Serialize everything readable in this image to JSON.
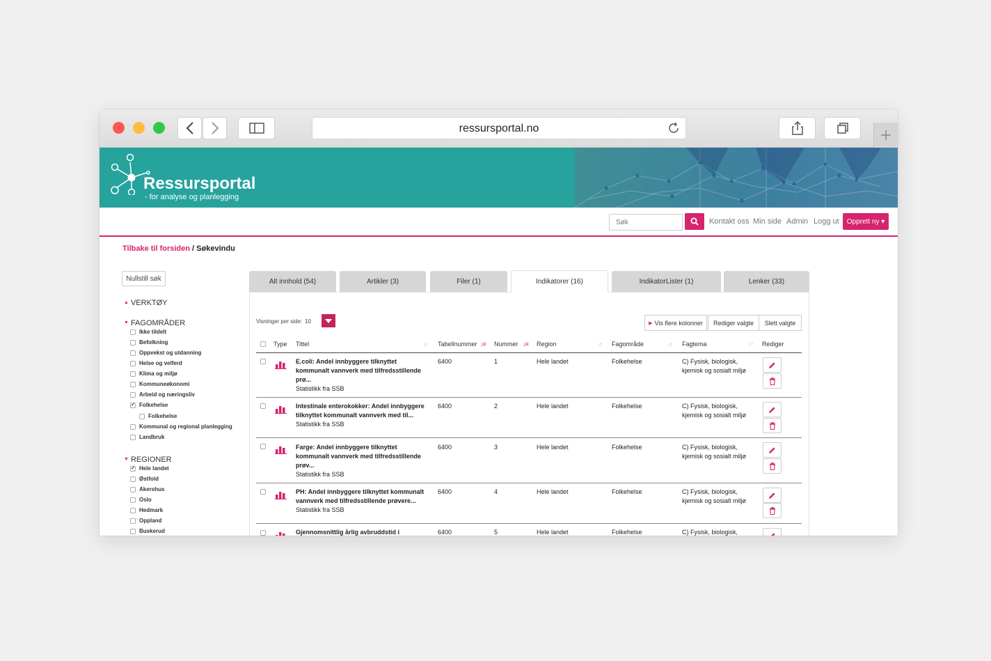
{
  "browser": {
    "url": "ressursportal.no"
  },
  "site": {
    "title": "Ressursportal",
    "subtitle": "- for analyse og planlegging"
  },
  "nav": {
    "search_placeholder": "Søk",
    "links": [
      "Kontakt oss",
      "Min side",
      "Admin",
      "Logg ut"
    ],
    "create_label": "Opprett ny ▾"
  },
  "breadcrumb": {
    "back": "Tilbake til forsiden",
    "sep": " / ",
    "current": "Søkevindu"
  },
  "sidebar": {
    "reset_label": "Nullstill søk",
    "verktoy": "VERKTØY",
    "fagomrader": "FAGOMRÅDER",
    "fag_items": [
      {
        "label": "Ikke tildelt",
        "checked": false
      },
      {
        "label": "Befolkning",
        "checked": false
      },
      {
        "label": "Oppvekst og utdanning",
        "checked": false
      },
      {
        "label": "Helse og velferd",
        "checked": false
      },
      {
        "label": "Klima og miljø",
        "checked": false
      },
      {
        "label": "Kommuneøkonomi",
        "checked": false
      },
      {
        "label": "Arbeid og næringsliv",
        "checked": false
      },
      {
        "label": "Folkehelse",
        "checked": true
      },
      {
        "label": "Folkehelse",
        "checked": false
      },
      {
        "label": "Kommunal og regional planlegging",
        "checked": false
      },
      {
        "label": "Landbruk",
        "checked": false
      }
    ],
    "regioner": "REGIONER",
    "region_items": [
      {
        "label": "Hele landet",
        "checked": true
      },
      {
        "label": "Østfold",
        "checked": false
      },
      {
        "label": "Akershus",
        "checked": false
      },
      {
        "label": "Oslo",
        "checked": false
      },
      {
        "label": "Hedmark",
        "checked": false
      },
      {
        "label": "Oppland",
        "checked": false
      },
      {
        "label": "Buskerud",
        "checked": false
      }
    ]
  },
  "tabs": [
    {
      "label": "Alt innhold (54)"
    },
    {
      "label": "Artikler (3)"
    },
    {
      "label": "Filer (1)"
    },
    {
      "label": "Indikatorer (16)",
      "active": true
    },
    {
      "label": "IndikatorLister (1)"
    },
    {
      "label": "Lenker (33)"
    }
  ],
  "table_controls": {
    "per_page_label": "Visninger per side:",
    "per_page_value": "10",
    "more_columns": "Vis flere kolonner",
    "edit_selected": "Rediger valgte",
    "delete_selected": "Slett valgte"
  },
  "table": {
    "columns": [
      "Type",
      "Tittel",
      "Tabellnummer",
      "Nummer",
      "Region",
      "Fagområde",
      "Fagtema",
      "Rediger"
    ],
    "rows": [
      {
        "title": "E.coli: Andel innbyggere tilknyttet kommunalt vannverk med tilfredsstillende prø...",
        "source": "Statistikk fra SSB",
        "tabell": "6400",
        "nummer": "1",
        "region": "Hele landet",
        "fagomrade": "Folkehelse",
        "fagtema": "C) Fysisk, biologisk, kjemisk og sosialt miljø"
      },
      {
        "title": "Intestinale enterokokker: Andel innbyggere tilknyttet kommunalt vannverk med til...",
        "source": "Statistikk fra SSB",
        "tabell": "6400",
        "nummer": "2",
        "region": "Hele landet",
        "fagomrade": "Folkehelse",
        "fagtema": "C) Fysisk, biologisk, kjemisk og sosialt miljø"
      },
      {
        "title": "Farge: Andel innbyggere tilknyttet kommunalt vannverk med tilfredsstillende prøv...",
        "source": "Statistikk fra SSB",
        "tabell": "6400",
        "nummer": "3",
        "region": "Hele landet",
        "fagomrade": "Folkehelse",
        "fagtema": "C) Fysisk, biologisk, kjemisk og sosialt miljø"
      },
      {
        "title": "PH: Andel innbyggere tilknyttet kommunalt vannverk med tilfredsstillende prøvere...",
        "source": "Statistikk fra SSB",
        "tabell": "6400",
        "nummer": "4",
        "region": "Hele landet",
        "fagomrade": "Folkehelse",
        "fagtema": "C) Fysisk, biologisk, kjemisk og sosialt miljø"
      },
      {
        "title": "Gjennomsnittlig årlig avbruddstid i",
        "source": "",
        "tabell": "6400",
        "nummer": "5",
        "region": "Hele landet",
        "fagomrade": "Folkehelse",
        "fagtema": "C) Fysisk, biologisk,"
      }
    ]
  },
  "colors": {
    "accent": "#d6246e",
    "banner": "#25a39c"
  }
}
